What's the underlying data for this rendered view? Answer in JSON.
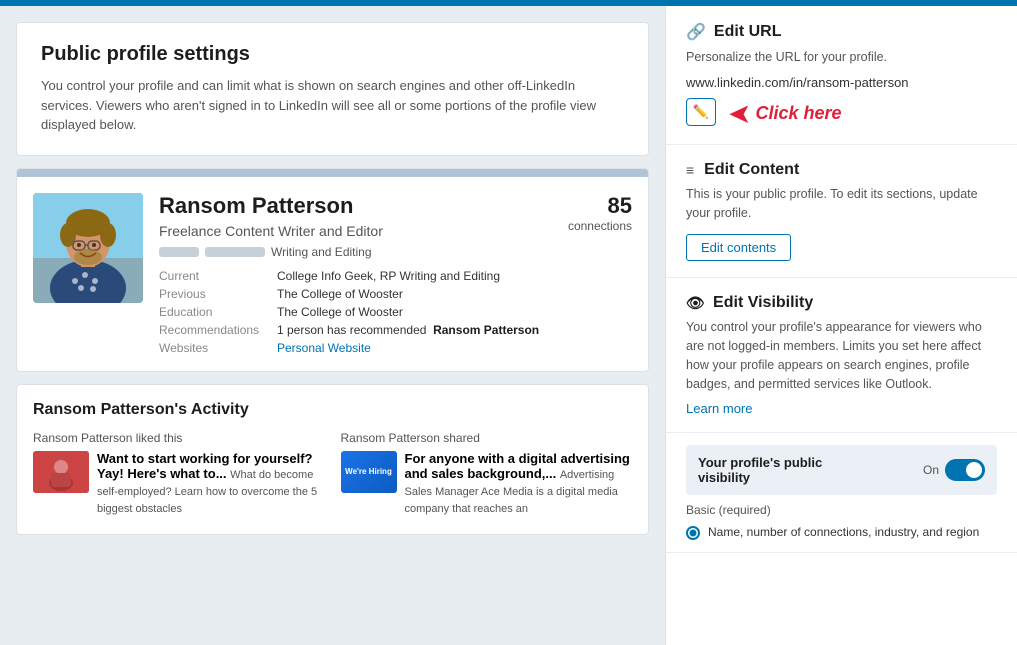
{
  "topBar": {},
  "leftPanel": {
    "settingsCard": {
      "title": "Public profile settings",
      "description": "You control your profile and can limit what is shown on search engines and other off-LinkedIn services. Viewers who aren't signed in to LinkedIn will see all or some portions of the profile view displayed below."
    },
    "profileCard": {
      "name": "Ransom Patterson",
      "title": "Freelance Content Writer and Editor",
      "skillsText": "Writing and Editing",
      "connections": "85",
      "connectionsLabel": "connections",
      "details": {
        "currentLabel": "Current",
        "currentValue": "College Info Geek, RP Writing and Editing",
        "previousLabel": "Previous",
        "previousValue": "The College of Wooster",
        "educationLabel": "Education",
        "educationValue": "The College of Wooster",
        "recommendationsLabel": "Recommendations",
        "recommendationsText": "1 person has recommended",
        "recommendationsName": "Ransom Patterson",
        "websitesLabel": "Websites",
        "websitesValue": "Personal Website"
      }
    },
    "activitySection": {
      "title": "Ransom Patterson's Activity",
      "col1": {
        "byLine": "Ransom Patterson liked this",
        "headline": "Want to start working for yourself? Yay! Here's what to...",
        "description": "What do become self-employed? Learn how to overcome the 5 biggest obstacles",
        "thumbText": "👤"
      },
      "col2": {
        "byLine": "Ransom Patterson shared",
        "headline": "For anyone with a digital advertising and sales background,...",
        "description": "Advertising Sales Manager Ace Media is a digital media company that reaches an",
        "thumbText": "We're Hiring"
      }
    }
  },
  "rightPanel": {
    "editUrl": {
      "title": "Edit URL",
      "description": "Personalize the URL for your profile.",
      "urlText": "www.linkedin.com/in/ransom-patterson",
      "editBtnIcon": "✏️",
      "clickHereText": "Click here"
    },
    "editContent": {
      "title": "Edit Content",
      "description": "This is your public profile. To edit its sections, update your profile.",
      "buttonLabel": "Edit contents"
    },
    "editVisibility": {
      "title": "Edit Visibility",
      "description": "You control your profile's appearance for viewers who are not logged-in members. Limits you set here affect how your profile appears on search engines, profile badges, and permitted services like Outlook.",
      "learnMoreText": "Learn more"
    },
    "publicVisibility": {
      "label": "Your profile's public visibility",
      "toggleOnLabel": "On"
    },
    "basicRequired": {
      "label": "Basic (required)",
      "radioItem": "Name, number of connections, industry, and region"
    }
  }
}
